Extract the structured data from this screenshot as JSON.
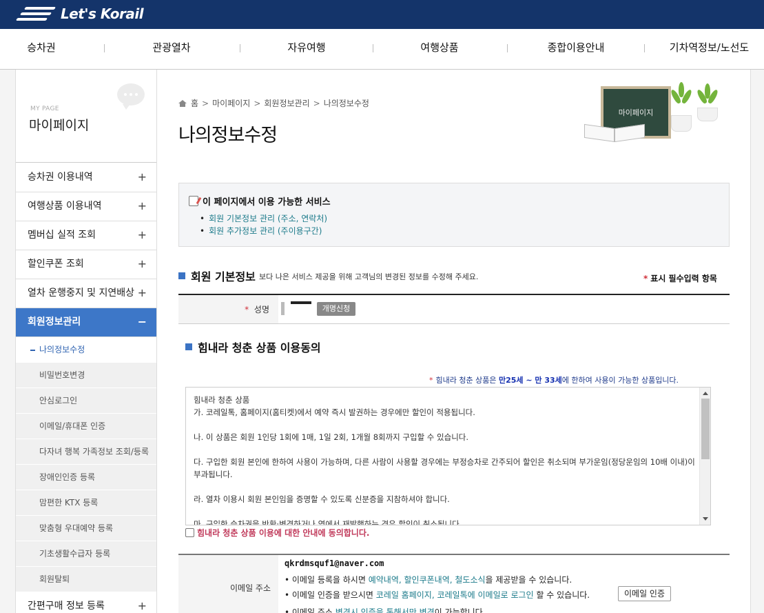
{
  "brand": {
    "name": "Let's Korail"
  },
  "nav": [
    "승차권",
    "관광열차",
    "자유여행",
    "여행상품",
    "종합이용안내",
    "기차역정보/노선도"
  ],
  "sidebar": {
    "title_en": "MY PAGE",
    "title": "마이페이지",
    "items": [
      {
        "label": "승차권 이용내역",
        "toggle": "+"
      },
      {
        "label": "여행상품 이용내역",
        "toggle": "+"
      },
      {
        "label": "멤버십 실적 조회",
        "toggle": "+"
      },
      {
        "label": "할인쿠폰 조회",
        "toggle": "+"
      },
      {
        "label": "열차 운행중지 및 지연배상",
        "toggle": "+"
      },
      {
        "label": "회원정보관리",
        "toggle": "−"
      }
    ],
    "sub_items": [
      "나의정보수정",
      "비밀번호변경",
      "안심로그인",
      "이메일/휴대폰 인증",
      "다자녀 행복 가족정보 조회/등록",
      "장애인인증 등록",
      "맘편한 KTX 등록",
      "맞춤형 우대예약 등록",
      "기초생활수급자 등록",
      "회원탈퇴"
    ],
    "last_item": {
      "label": "간편구매 정보 등록",
      "toggle": "+"
    }
  },
  "breadcrumb": [
    "홈",
    "마이페이지",
    "회원정보관리",
    "나의정보수정"
  ],
  "page_title": "나의정보수정",
  "illustration_text": "마이페이지",
  "services": {
    "title": "이 페이지에서 이용 가능한 서비스",
    "items": [
      "회원 기본정보 관리 (주소, 연락처)",
      "회원 추가정보 관리 (주이용구간)"
    ]
  },
  "basic_info": {
    "title": "회원 기본정보",
    "description": "보다 나은 서비스 제공을 위해 고객님의 변경된 정보를 수정해 주세요.",
    "required_note": "표시 필수입력 항목",
    "name_label": "성명",
    "rename_button": "개명신청"
  },
  "youth": {
    "title": "힘내라 청춘 상품 이용동의",
    "note_prefix": "힘내라 청춘 상품은",
    "note_age": "만25세 ~ 만 33세",
    "note_suffix": "에 한하여 사용이 가능한 상품입니다.",
    "terms": [
      "힘내라 청춘 상품",
      "가. 코레일톡, 홈페이지(홈티켓)에서 예약 즉시 발권하는 경우에만 할인이 적용됩니다.",
      "나. 이 상품은 회원 1인당 1회에 1매, 1일 2회, 1개월 8회까지 구입할 수 있습니다.",
      "다. 구입한 회원 본인에 한하여 사용이 가능하며, 다른 사람이 사용할 경우에는 부정승차로 간주되어 할인은 취소되며 부가운임(정당운임의 10배 이내)이 부과됩니다.",
      "라. 열차 이용시 회원 본인임을 증명할 수 있도록 신분증을 지참하셔야 합니다.",
      "마. 구입한 승차권을 반환·변경하거나 역에서 재발행하는 경우 할인이 취소됩니다."
    ],
    "agree_label": "힘내라 청춘 상품 이용에 대한 안내에 동의합니다."
  },
  "email": {
    "label": "이메일 주소",
    "value": "qkrdmsquf1@naver.com",
    "line1_a": "• 이메일 등록을 하시면 ",
    "line1_b": "예약내역, 할인쿠폰내역, 철도소식",
    "line1_c": "을 제공받을 수 있습니다.",
    "line2_a": "• 이메일 인증을 받으시면 ",
    "line2_b": "코레일 홈페이지, 코레일톡에 이메일로 로그인",
    "line2_c": " 할 수 있습니다.",
    "line3_a": "• 이메일 주소 ",
    "line3_b": "변경시 인증을 통해서만 변경",
    "line3_c": "이 가능합니다.",
    "verify_button": "이메일 인증"
  }
}
